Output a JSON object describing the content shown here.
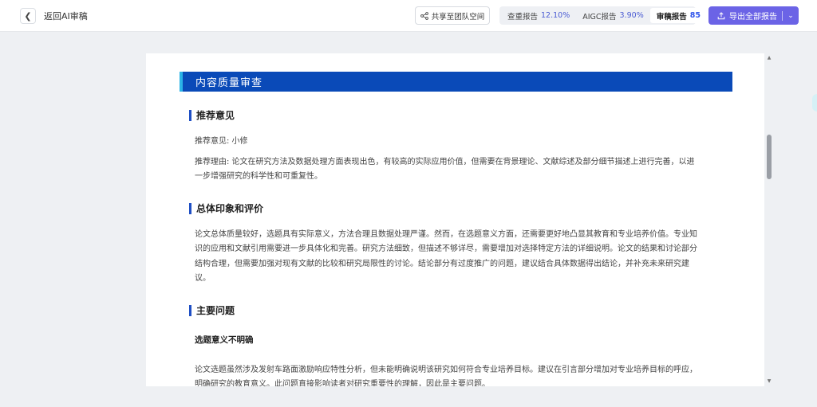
{
  "header": {
    "back_label": "返回AI审稿",
    "share_label": "共享至团队空间",
    "tabs": [
      {
        "label": "查重报告",
        "value": "12.10%"
      },
      {
        "label": "AIGC报告",
        "value": "3.90%"
      },
      {
        "label": "审稿报告",
        "value": "85"
      }
    ],
    "export_label": "导出全部报告"
  },
  "doc": {
    "banner": "内容质量审查",
    "recommend": {
      "heading": "推荐意见",
      "opinion": "推荐意见: 小修",
      "reason_line1": "推荐理由: 论文在研究方法及数据处理方面表现出色，有较高的实际应用价值，但需要在背景理论、文献综述及部分细节描述上进行完善，以进",
      "reason_line2": "一步增强研究的科学性和可重复性。"
    },
    "overall": {
      "heading": "总体印象和评价",
      "line1": "论文总体质量较好，选题具有实际意义，方法合理且数据处理严谨。然而，在选题意义方面，还需要更好地凸显其教育和专业培养价值。专业知",
      "line2": "识的应用和文献引用需要进一步具体化和完善。研究方法细致，但描述不够详尽，需要增加对选择特定方法的详细说明。论文的结果和讨论部分",
      "line3": "结构合理，但需要加强对现有文献的比较和研究局限性的讨论。结论部分有过度推广的问题，建议结合具体数据得出结论，并补充未来研究建",
      "line4": "议。"
    },
    "issues": {
      "heading": "主要问题",
      "sub1": "选题意义不明确",
      "line1": "论文选题虽然涉及发射车路面激励响应特性分析，但未能明确说明该研究如何符合专业培养目标。建议在引言部分增加对专业培养目标的呼应，",
      "line2": "明确研究的教育意义。此问题直接影响读者对研究重要性的理解，因此是主要问题。"
    }
  },
  "colors": {
    "banner": "#0a4ab8",
    "accent": "#2bb3e6",
    "export": "#6b63e6"
  }
}
